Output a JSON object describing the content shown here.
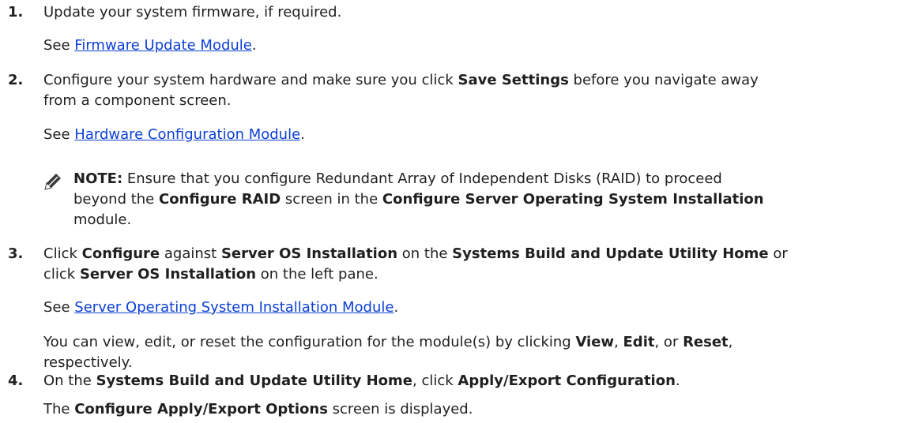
{
  "steps": [
    {
      "number": "1.",
      "text_1": "Update your system firmware, if required.",
      "see": "See ",
      "link": "Firmware Update Module",
      "dot": "."
    },
    {
      "number": "2.",
      "text_1a": "Configure your system hardware and make sure you click ",
      "bold_1": "Save Settings",
      "text_1b": " before you navigate away",
      "text_2": "from a component screen.",
      "see": "See ",
      "link": "Hardware Configuration Module",
      "dot": ".",
      "note": {
        "label": "NOTE:",
        "l1": " Ensure that you configure Redundant Array of Independent Disks (RAID) to proceed",
        "l2a": "beyond the ",
        "b1": "Configure RAID",
        "l2b": " screen in the ",
        "b2": "Configure Server Operating System Installation",
        "l3": "module."
      }
    },
    {
      "number": "3.",
      "t1": "Click ",
      "b1": "Configure",
      "t2": " against ",
      "b2": "Server OS Installation",
      "t3": " on the ",
      "b3": "Systems Build and Update Utility Home",
      "t4": " or",
      "t5": "click ",
      "b4": "Server OS Installation",
      "t6": " on the left pane.",
      "see": "See ",
      "link": "Server Operating System Installation Module",
      "dot": ".",
      "p1": "You can view, edit, or reset the configuration for the module(s) by clicking ",
      "pb1": "View",
      "p2": ", ",
      "pb2": "Edit",
      "p3": ", or ",
      "pb3": "Reset",
      "p4": ",",
      "p5": "respectively."
    },
    {
      "number": "4.",
      "t1": "On the ",
      "b1": "Systems Build and Update Utility Home",
      "t2": ", click ",
      "b2": "Apply/Export Configuration",
      "t3": ".",
      "t4": "The ",
      "b3": "Configure Apply/Export Options",
      "t5": " screen is displayed."
    }
  ],
  "icons": {
    "note": "pencil-icon"
  },
  "colors": {
    "link": "#0b3fd6",
    "text": "#1f1f1f"
  }
}
